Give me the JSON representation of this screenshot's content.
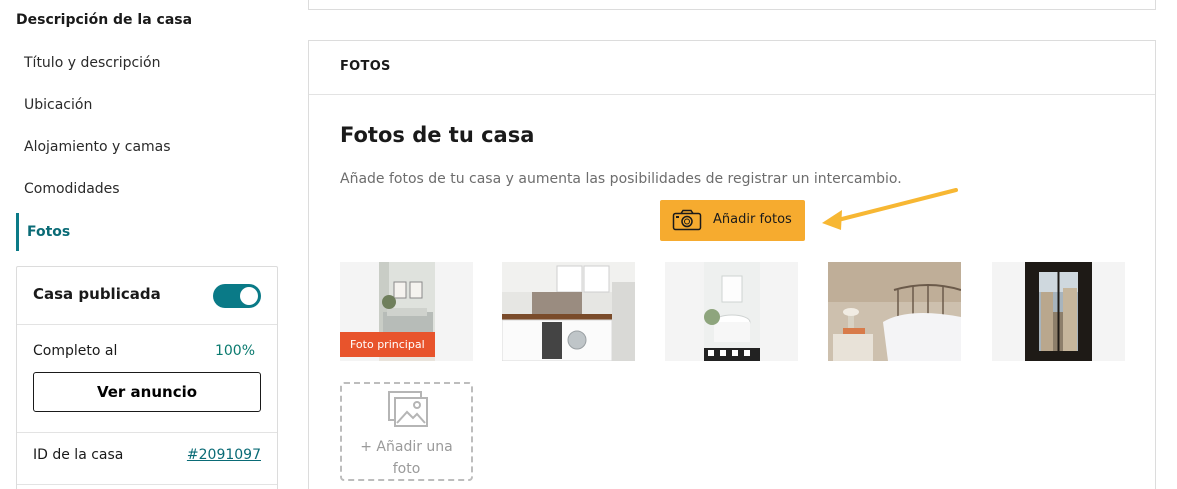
{
  "sidebar": {
    "section_title": "Descripción de la casa",
    "items": [
      {
        "label": "Título y descripción"
      },
      {
        "label": "Ubicación"
      },
      {
        "label": "Alojamiento y camas"
      },
      {
        "label": "Comodidades"
      },
      {
        "label": "Fotos",
        "active": true
      }
    ],
    "status": {
      "published_label": "Casa publicada",
      "published": true,
      "complete_label": "Completo al",
      "complete_value": "100%",
      "view_button": "Ver anuncio",
      "id_label": "ID de la casa",
      "id_value": "#2091097"
    }
  },
  "photos_section": {
    "header": "FOTOS",
    "title": "Fotos de tu casa",
    "description": "Añade fotos de tu casa y aumenta las posibilidades de registrar un intercambio.",
    "add_button": "Añadir fotos",
    "main_badge": "Foto principal",
    "photos": [
      {
        "icon": "living-room-photo"
      },
      {
        "icon": "kitchen-photo"
      },
      {
        "icon": "bathroom-photo"
      },
      {
        "icon": "bedroom-photo"
      },
      {
        "icon": "window-view-photo"
      }
    ],
    "add_photo_label": "+ Añadir una foto"
  },
  "colors": {
    "accent": "#0a7a87",
    "add_button": "#f6ab2f",
    "badge": "#e8542c",
    "arrow": "#f7b733"
  }
}
